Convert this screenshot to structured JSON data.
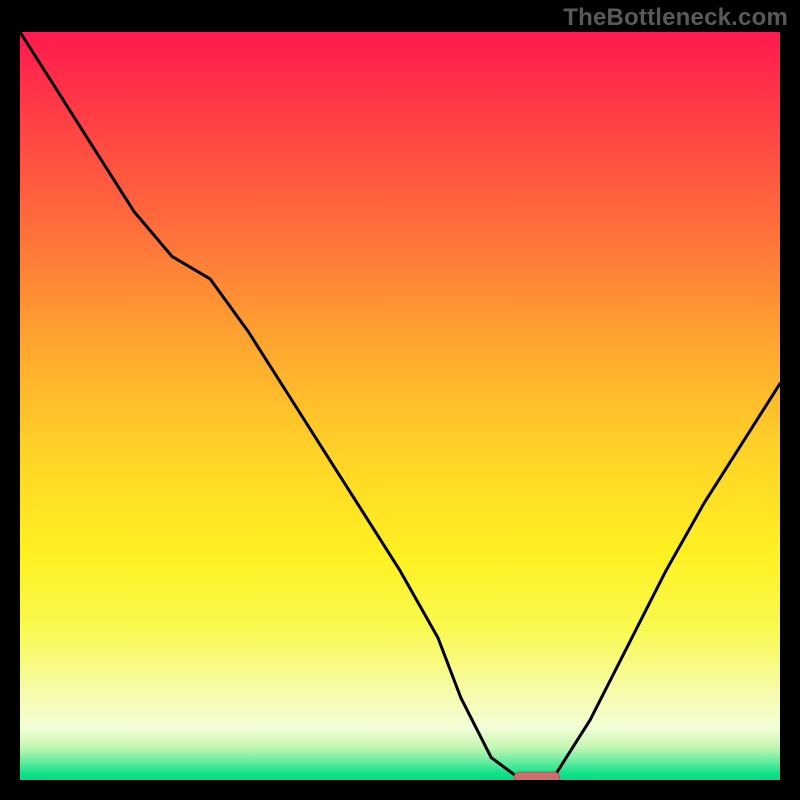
{
  "watermark": "TheBottleneck.com",
  "colors": {
    "frame": "#000000",
    "curve": "#000000",
    "marker_fill": "#cc6f6e",
    "marker_stroke": "#b45857",
    "gradient_stops": [
      {
        "offset": 0.0,
        "color": "#ff1a4f"
      },
      {
        "offset": 0.1,
        "color": "#ff3a46"
      },
      {
        "offset": 0.25,
        "color": "#ff6a3c"
      },
      {
        "offset": 0.4,
        "color": "#ffa031"
      },
      {
        "offset": 0.55,
        "color": "#ffd028"
      },
      {
        "offset": 0.7,
        "color": "#fff122"
      },
      {
        "offset": 0.8,
        "color": "#f8fa52"
      },
      {
        "offset": 0.88,
        "color": "#f7fba8"
      },
      {
        "offset": 0.93,
        "color": "#f3fdd6"
      },
      {
        "offset": 0.955,
        "color": "#c7f7b4"
      },
      {
        "offset": 0.975,
        "color": "#66eda0"
      },
      {
        "offset": 0.99,
        "color": "#17e38c"
      },
      {
        "offset": 1.0,
        "color": "#00de84"
      }
    ]
  },
  "chart_data": {
    "type": "line",
    "title": "",
    "xlabel": "",
    "ylabel": "",
    "xlim": [
      0,
      100
    ],
    "ylim": [
      0,
      100
    ],
    "x": [
      0,
      5,
      10,
      15,
      20,
      25,
      30,
      35,
      40,
      45,
      50,
      55,
      58,
      62,
      66,
      70,
      75,
      80,
      85,
      90,
      95,
      100
    ],
    "values": [
      100,
      92,
      84,
      76,
      70,
      67,
      60,
      52,
      44,
      36,
      28,
      19,
      11,
      3,
      0,
      0,
      8,
      18,
      28,
      37,
      45,
      53
    ],
    "marker": {
      "x": 68,
      "y": 0,
      "width": 6,
      "height": 1.6
    },
    "note": "y = bottleneck percentage (0 at bottom/green, 100 at top/red); x = relative component scale; values estimated from pixels"
  }
}
